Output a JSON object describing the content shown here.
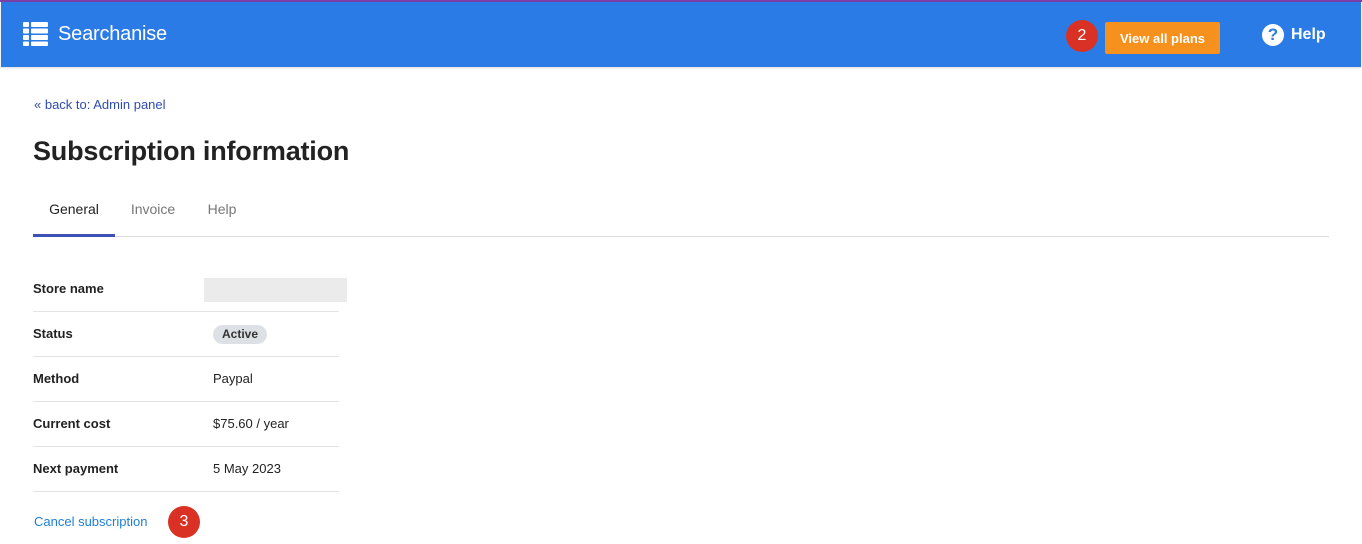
{
  "header": {
    "app_name": "Searchanise",
    "step_badge_top": "2",
    "plans_button_label": "View all plans",
    "help_label": "Help",
    "help_icon_glyph": "?",
    "colors": {
      "bar": "#2b7be6",
      "plans_button": "#f7911e",
      "badge": "#d93224"
    }
  },
  "breadcrumb": {
    "back_link": "« back to: Admin panel"
  },
  "page": {
    "title": "Subscription information"
  },
  "tabs": [
    {
      "label": "General",
      "active": true
    },
    {
      "label": "Invoice",
      "active": false
    },
    {
      "label": "Help",
      "active": false
    }
  ],
  "details": {
    "store_name_label": "Store name",
    "store_name_value": "",
    "status_label": "Status",
    "status_value": "Active",
    "method_label": "Method",
    "method_value": "Paypal",
    "cost_label": "Current cost",
    "cost_value": "$75.60 / year",
    "next_payment_label": "Next payment",
    "next_payment_value": "5 May 2023"
  },
  "footer": {
    "cancel_link": "Cancel subscription",
    "step_badge_bottom": "3"
  }
}
